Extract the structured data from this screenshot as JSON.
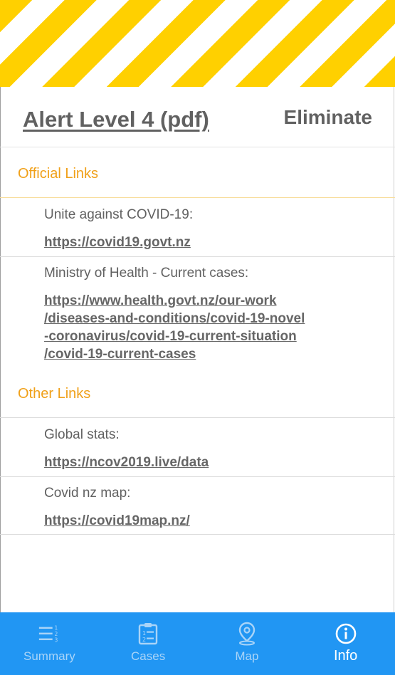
{
  "alert": {
    "title": "Alert Level 4 (pdf)",
    "status": "Eliminate"
  },
  "sections": {
    "official": {
      "header": "Official Links",
      "items": [
        {
          "label": "Unite against COVID-19:",
          "url": "https://covid19.govt.nz"
        },
        {
          "label": "Ministry of Health - Current cases:",
          "url": "https://www.health.govt.nz/our-work\n/diseases-and-conditions/covid-19-novel\n-coronavirus/covid-19-current-situation\n/covid-19-current-cases"
        }
      ]
    },
    "other": {
      "header": "Other Links",
      "items": [
        {
          "label": "Global stats:",
          "url": "https://ncov2019.live/data"
        },
        {
          "label": "Covid nz map:",
          "url": "https://covid19map.nz/"
        }
      ]
    }
  },
  "nav": {
    "items": [
      {
        "label": "Summary",
        "icon": "list-numbered-icon"
      },
      {
        "label": "Cases",
        "icon": "clipboard-list-icon"
      },
      {
        "label": "Map",
        "icon": "map-pin-icon"
      },
      {
        "label": "Info",
        "icon": "info-icon"
      }
    ],
    "active": "Info"
  },
  "colors": {
    "accent": "#f0a019",
    "stripe": "#ffd000",
    "nav_bg": "#2196f3",
    "nav_inactive": "#a9d4f8",
    "text": "#616161"
  }
}
